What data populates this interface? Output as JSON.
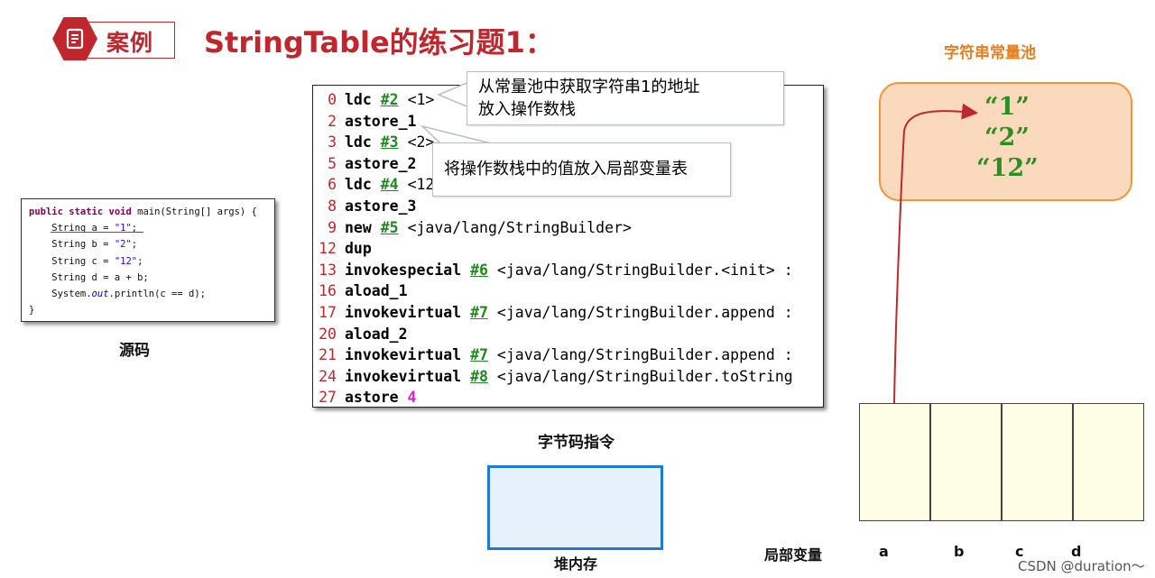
{
  "header": {
    "badge_label": "案例",
    "title": "StringTable的练习题1："
  },
  "source": {
    "caption": "源码",
    "lines": [
      "public static void main(String[] args) {",
      "    String a = \"1\";",
      "    String b = \"2\";",
      "    String c = \"12\";",
      "    String d = a + b;",
      "    System.out.println(c == d);",
      "}"
    ]
  },
  "bytecode": {
    "caption": "字节码指令",
    "lines": [
      {
        "num": "0",
        "op": "ldc",
        "ref": "#2",
        "arg": "<1>"
      },
      {
        "num": "2",
        "op": "astore_1",
        "ref": "",
        "arg": ""
      },
      {
        "num": "3",
        "op": "ldc",
        "ref": "#3",
        "arg": "<2>"
      },
      {
        "num": "5",
        "op": "astore_2",
        "ref": "",
        "arg": ""
      },
      {
        "num": "6",
        "op": "ldc",
        "ref": "#4",
        "arg": "<12>"
      },
      {
        "num": "8",
        "op": "astore_3",
        "ref": "",
        "arg": ""
      },
      {
        "num": "9",
        "op": "new",
        "ref": "#5",
        "arg": "<java/lang/StringBuilder>"
      },
      {
        "num": "12",
        "op": "dup",
        "ref": "",
        "arg": ""
      },
      {
        "num": "13",
        "op": "invokespecial",
        "ref": "#6",
        "arg": "<java/lang/StringBuilder.<init> :"
      },
      {
        "num": "16",
        "op": "aload_1",
        "ref": "",
        "arg": ""
      },
      {
        "num": "17",
        "op": "invokevirtual",
        "ref": "#7",
        "arg": "<java/lang/StringBuilder.append :"
      },
      {
        "num": "20",
        "op": "aload_2",
        "ref": "",
        "arg": ""
      },
      {
        "num": "21",
        "op": "invokevirtual",
        "ref": "#7",
        "arg": "<java/lang/StringBuilder.append :"
      },
      {
        "num": "24",
        "op": "invokevirtual",
        "ref": "#8",
        "arg": "<java/lang/StringBuilder.toString"
      },
      {
        "num": "27",
        "op": "astore",
        "ref": "",
        "arg": "",
        "index": "4"
      }
    ]
  },
  "callouts": {
    "ldc_line1": "从常量池中获取字符串1的地址",
    "ldc_line2": "放入操作数栈",
    "astore": "将操作数栈中的值放入局部变量表"
  },
  "string_pool": {
    "title": "字符串常量池",
    "entries": [
      "“1”",
      "“2”",
      "“12”"
    ]
  },
  "heap": {
    "caption": "堆内存"
  },
  "locals": {
    "caption": "局部变量",
    "slots": [
      "a",
      "b",
      "c",
      "d"
    ]
  },
  "watermark": "CSDN @duration～",
  "colors": {
    "accent_red": "#c0272d",
    "pool_orange": "#f0953a",
    "pool_fill": "#fbd9bd",
    "string_green": "#2a9020",
    "heap_blue": "#1f7ad6"
  }
}
